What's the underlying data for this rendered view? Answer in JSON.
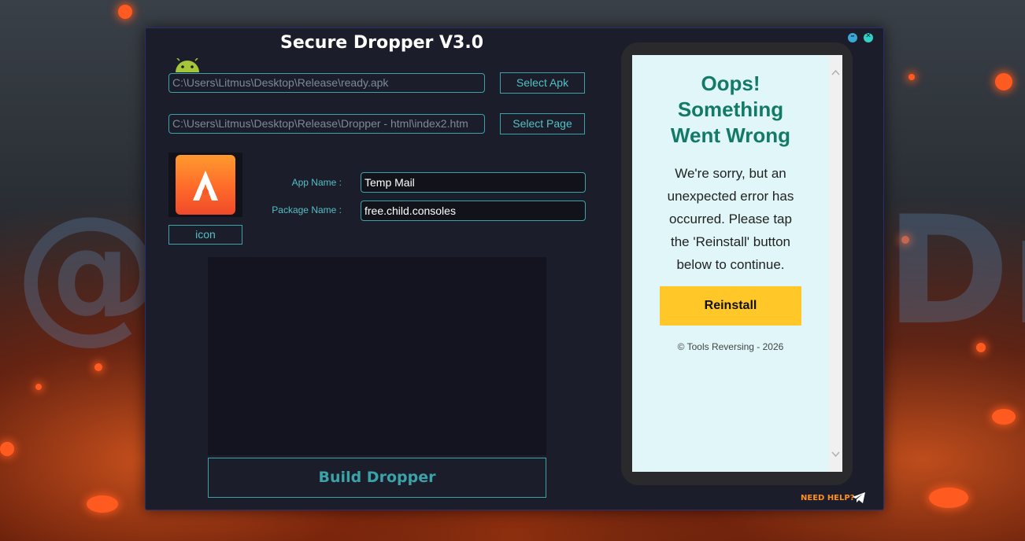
{
  "app": {
    "title": "Secure Dropper V3.0",
    "minimize_glyph": "–",
    "close_glyph": "✕"
  },
  "apk": {
    "path": "C:\\Users\\Litmus\\Desktop\\Release\\ready.apk",
    "button": "Select Apk"
  },
  "page": {
    "path": "C:\\Users\\Litmus\\Desktop\\Release\\Dropper -  html\\index2.htm",
    "button": "Select Page"
  },
  "icon": {
    "label": "icon"
  },
  "fields": {
    "app_name_label": "App Name :",
    "app_name_value": "Temp Mail",
    "package_name_label": "Package Name :",
    "package_name_value": "free.child.consoles"
  },
  "build": {
    "label": "Build Dropper"
  },
  "help": {
    "label": "NEED HELP?"
  },
  "preview": {
    "heading_line1": "Oops!",
    "heading_line2": "Something",
    "heading_line3": "Went Wrong",
    "message_line1": "We're sorry, but an",
    "message_line2": "unexpected error has",
    "message_line3": "occurred. Please tap",
    "message_line4": "the 'Reinstall' button",
    "message_line5": "below to continue.",
    "button": "Reinstall",
    "footer": "© Tools Reversing - 2026"
  },
  "background": {
    "watermark_left": "@",
    "watermark_right": "Dr"
  },
  "colors": {
    "accent": "#3aa3a8",
    "heading": "#137a68",
    "reinstall": "#ffc727",
    "help": "#ff8f1f"
  }
}
